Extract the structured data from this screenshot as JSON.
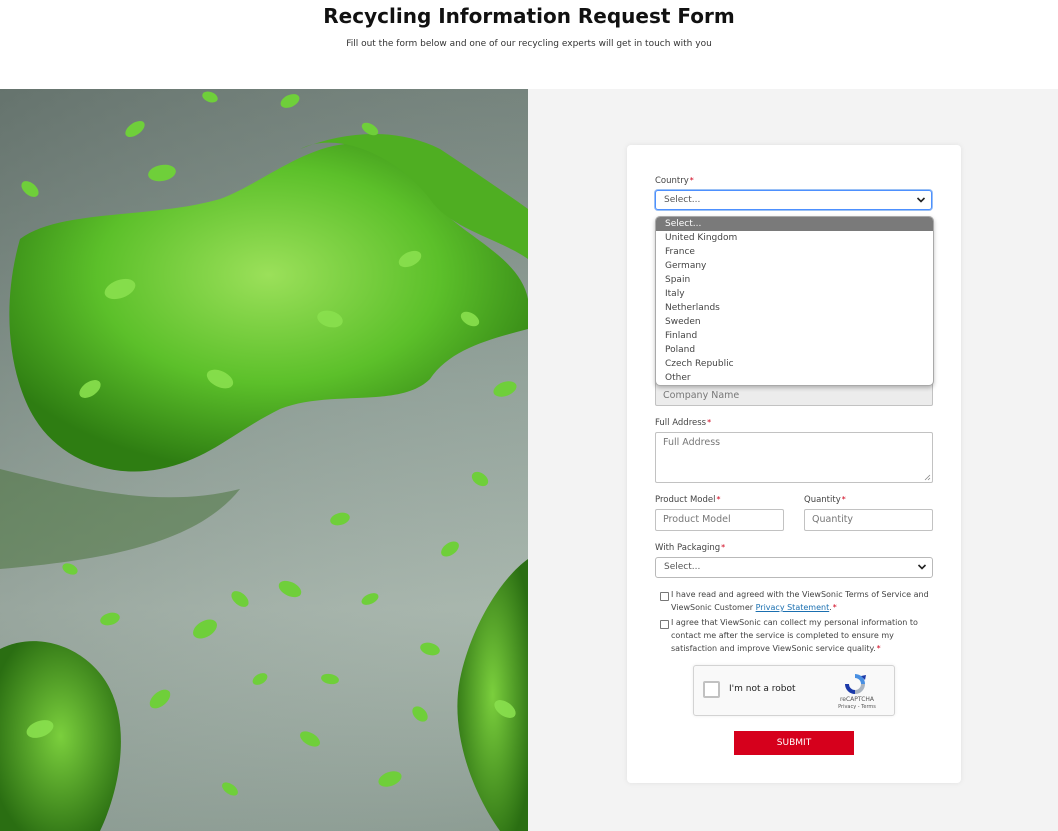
{
  "header": {
    "title": "Recycling Information Request Form",
    "subtitle": "Fill out the form below and one of our recycling experts will get in touch with you"
  },
  "form": {
    "country": {
      "label": "Country",
      "value": "Select...",
      "options": [
        "Select...",
        "United Kingdom",
        "France",
        "Germany",
        "Spain",
        "Italy",
        "Netherlands",
        "Sweden",
        "Finland",
        "Poland",
        "Czech Republic",
        "Other"
      ]
    },
    "company": {
      "placeholder": "Company Name"
    },
    "address": {
      "label": "Full Address",
      "placeholder": "Full Address"
    },
    "product_model": {
      "label": "Product Model",
      "placeholder": "Product Model"
    },
    "quantity": {
      "label": "Quantity",
      "placeholder": "Quantity"
    },
    "packaging": {
      "label": "With Packaging",
      "value": "Select..."
    },
    "required_mark": "*",
    "terms": {
      "text_before": "I have read and agreed with the ViewSonic Terms of Service and ViewSonic Customer ",
      "link": "Privacy Statement",
      "text_after": "."
    },
    "consent": {
      "text": "I agree that ViewSonic can collect my personal information to contact me after the service is completed to ensure my satisfaction and improve ViewSonic service quality."
    },
    "recaptcha": {
      "label": "I'm not a robot",
      "brand": "reCAPTCHA",
      "terms": "Privacy - Terms"
    },
    "submit_label": "SUBMIT"
  },
  "colors": {
    "submit": "#d6001c",
    "required": "#d0021b",
    "link": "#1a6fb0",
    "leaf_green": "#5cc02a"
  }
}
